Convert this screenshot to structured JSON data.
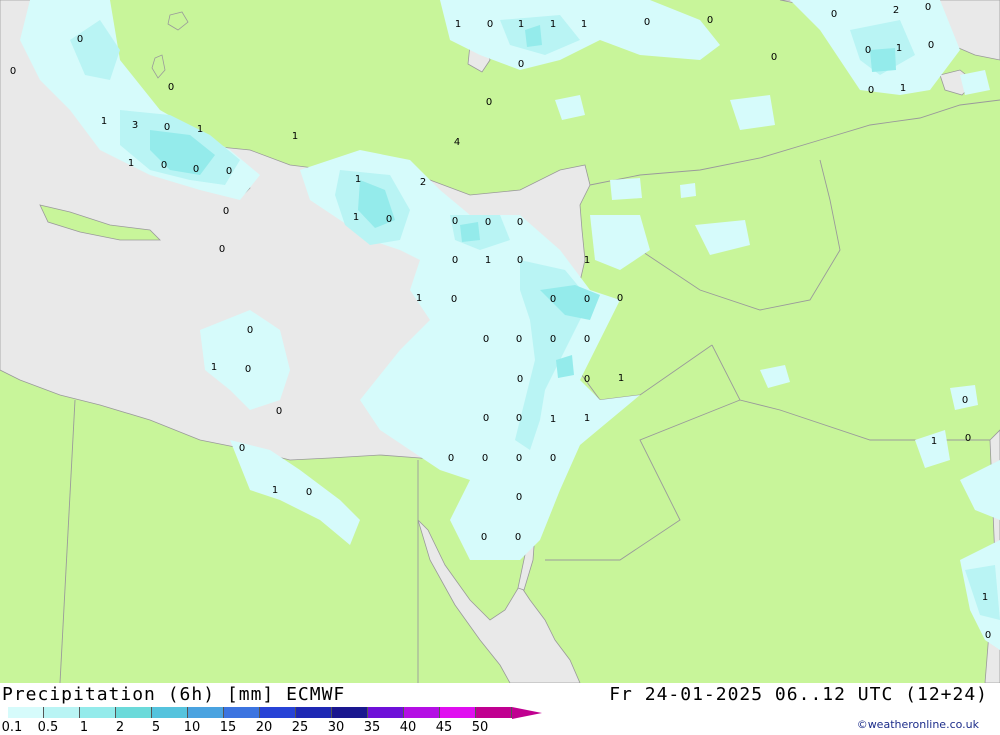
{
  "title": "Precipitation (6h) [mm] ECMWF",
  "valid_time": "Fr 24-01-2025 06..12 UTC (12+24)",
  "credit": "©weatheronline.co.uk",
  "colors": {
    "land": "#c8f59a",
    "sea": "#e9e9e9",
    "border": "#9a9a9a"
  },
  "legend": {
    "ticks": [
      "0.1",
      "0.5",
      "1",
      "2",
      "5",
      "10",
      "15",
      "20",
      "25",
      "30",
      "35",
      "40",
      "45",
      "50"
    ],
    "colors": [
      "#d6fbfb",
      "#b9f4f4",
      "#94ebeb",
      "#6bdada",
      "#55c3dd",
      "#4aa3e0",
      "#3c74e0",
      "#2743d6",
      "#1e28b4",
      "#1a178f",
      "#6e10d8",
      "#b40ee4",
      "#e00ef0",
      "#c00090"
    ]
  },
  "values": [
    {
      "t": "1"
    },
    {
      "t": "0"
    },
    {
      "t": "1"
    },
    {
      "t": "1"
    },
    {
      "t": "1"
    },
    {
      "t": "0"
    },
    {
      "t": "0"
    },
    {
      "t": "0"
    },
    {
      "t": "2"
    },
    {
      "t": "0"
    },
    {
      "t": "0"
    },
    {
      "t": "0"
    },
    {
      "t": "1"
    },
    {
      "t": "0"
    },
    {
      "t": "0"
    },
    {
      "t": "0"
    },
    {
      "t": "0"
    },
    {
      "t": "0"
    },
    {
      "t": "0"
    },
    {
      "t": "1"
    },
    {
      "t": "0"
    },
    {
      "t": "1"
    },
    {
      "t": "3"
    },
    {
      "t": "0"
    },
    {
      "t": "1"
    },
    {
      "t": "1"
    },
    {
      "t": "4"
    },
    {
      "t": "1"
    },
    {
      "t": "0"
    },
    {
      "t": "0"
    },
    {
      "t": "0"
    },
    {
      "t": "1"
    },
    {
      "t": "2"
    },
    {
      "t": "0"
    },
    {
      "t": "1"
    },
    {
      "t": "0"
    },
    {
      "t": "0"
    },
    {
      "t": "0"
    },
    {
      "t": "0"
    },
    {
      "t": "0"
    },
    {
      "t": "0"
    },
    {
      "t": "1"
    },
    {
      "t": "0"
    },
    {
      "t": "1"
    },
    {
      "t": "1"
    },
    {
      "t": "0"
    },
    {
      "t": "0"
    },
    {
      "t": "0"
    },
    {
      "t": "0"
    },
    {
      "t": "0"
    },
    {
      "t": "0"
    },
    {
      "t": "0"
    },
    {
      "t": "0"
    },
    {
      "t": "0"
    },
    {
      "t": "1"
    },
    {
      "t": "0"
    },
    {
      "t": "0"
    },
    {
      "t": "0"
    },
    {
      "t": "1"
    },
    {
      "t": "0"
    },
    {
      "t": "0"
    },
    {
      "t": "0"
    },
    {
      "t": "0"
    },
    {
      "t": "1"
    },
    {
      "t": "1"
    },
    {
      "t": "1"
    },
    {
      "t": "0"
    },
    {
      "t": "0"
    },
    {
      "t": "0"
    },
    {
      "t": "0"
    },
    {
      "t": "0"
    },
    {
      "t": "0"
    },
    {
      "t": "1"
    },
    {
      "t": "0"
    }
  ]
}
